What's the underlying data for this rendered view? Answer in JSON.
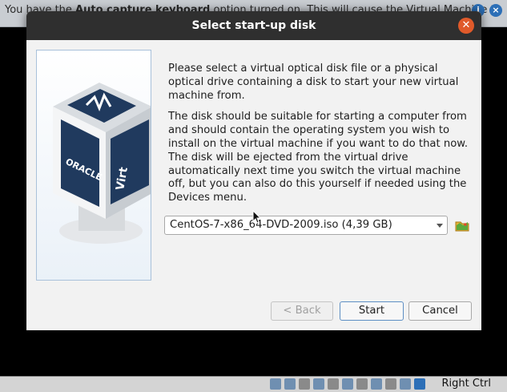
{
  "notification": {
    "text_before": "You have the ",
    "text_bold": "Auto capture keyboard",
    "text_after": " option turned on. This will cause the Virtual Machine to"
  },
  "dialog": {
    "title": "Select start-up disk",
    "paragraph1": "Please select a virtual optical disk file or a physical optical drive containing a disk to start your new virtual machine from.",
    "paragraph2": "The disk should be suitable for starting a computer from and should contain the operating system you wish to install on the virtual machine if you want to do that now. The disk will be ejected from the virtual drive automatically next time you switch the virtual machine off, but you can also do this yourself if needed using the Devices menu.",
    "disk_selected": "CentOS-7-x86_64-DVD-2009.iso (4,39 GB)",
    "buttons": {
      "back": "< Back",
      "start": "Start",
      "cancel": "Cancel"
    }
  },
  "statusbar": {
    "host_key": "Right Ctrl"
  },
  "colors": {
    "titlebar": "#2f2f2f",
    "close_button": "#e05a2a",
    "accent_border": "#5e8fc4"
  }
}
